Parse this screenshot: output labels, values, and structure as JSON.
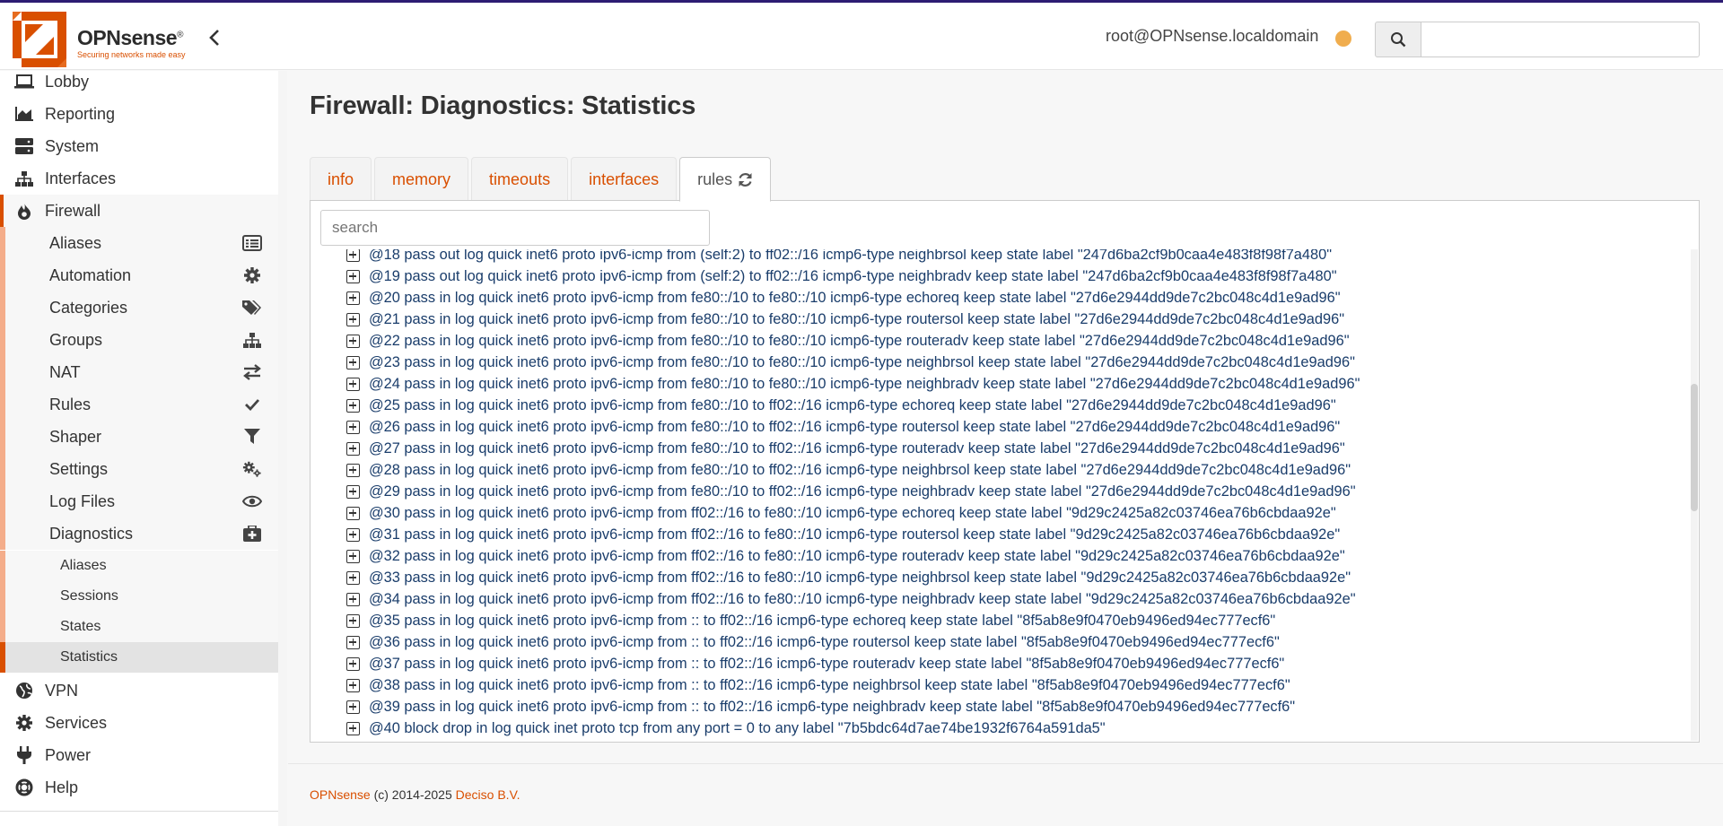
{
  "colors": {
    "accent": "#d94f00",
    "header_line": "#2d1c73",
    "status_dot": "#f0ad4e",
    "rule_text": "#1a3d6b"
  },
  "header": {
    "brand": "OPNsense",
    "brand_mark": "®",
    "tagline": "Securing networks made easy",
    "user": "root@OPNsense.localdomain",
    "search_placeholder": ""
  },
  "sidebar": {
    "items": [
      {
        "label": "Lobby",
        "icon": "laptop-icon"
      },
      {
        "label": "Reporting",
        "icon": "area-chart-icon"
      },
      {
        "label": "System",
        "icon": "server-icon"
      },
      {
        "label": "Interfaces",
        "icon": "sitemap-icon"
      },
      {
        "label": "Firewall",
        "icon": "fire-icon"
      },
      {
        "label": "VPN",
        "icon": "globe-icon"
      },
      {
        "label": "Services",
        "icon": "cog-icon"
      },
      {
        "label": "Power",
        "icon": "plug-icon"
      },
      {
        "label": "Help",
        "icon": "life-ring-icon"
      }
    ],
    "firewall_sub": [
      {
        "label": "Aliases",
        "icon": "list-icon"
      },
      {
        "label": "Automation",
        "icon": "cog-icon"
      },
      {
        "label": "Categories",
        "icon": "tags-icon"
      },
      {
        "label": "Groups",
        "icon": "sitemap-icon"
      },
      {
        "label": "NAT",
        "icon": "exchange-icon"
      },
      {
        "label": "Rules",
        "icon": "check-icon"
      },
      {
        "label": "Shaper",
        "icon": "filter-icon"
      },
      {
        "label": "Settings",
        "icon": "cogs-icon"
      },
      {
        "label": "Log Files",
        "icon": "eye-icon"
      },
      {
        "label": "Diagnostics",
        "icon": "medkit-icon"
      }
    ],
    "diagnostics_sub": [
      "Aliases",
      "Sessions",
      "States",
      "Statistics"
    ]
  },
  "page": {
    "title": "Firewall: Diagnostics: Statistics",
    "tabs": [
      "info",
      "memory",
      "timeouts",
      "interfaces",
      "rules"
    ],
    "active_tab": "rules",
    "search_placeholder": "search"
  },
  "rules": [
    "@18 pass out log quick inet6 proto ipv6-icmp from (self:2) to ff02::/16 icmp6-type neighbrsol keep state label \"247d6ba2cf9b0caa4e483f8f98f7a480\"",
    "@19 pass out log quick inet6 proto ipv6-icmp from (self:2) to ff02::/16 icmp6-type neighbradv keep state label \"247d6ba2cf9b0caa4e483f8f98f7a480\"",
    "@20 pass in log quick inet6 proto ipv6-icmp from fe80::/10 to fe80::/10 icmp6-type echoreq keep state label \"27d6e2944dd9de7c2bc048c4d1e9ad96\"",
    "@21 pass in log quick inet6 proto ipv6-icmp from fe80::/10 to fe80::/10 icmp6-type routersol keep state label \"27d6e2944dd9de7c2bc048c4d1e9ad96\"",
    "@22 pass in log quick inet6 proto ipv6-icmp from fe80::/10 to fe80::/10 icmp6-type routeradv keep state label \"27d6e2944dd9de7c2bc048c4d1e9ad96\"",
    "@23 pass in log quick inet6 proto ipv6-icmp from fe80::/10 to fe80::/10 icmp6-type neighbrsol keep state label \"27d6e2944dd9de7c2bc048c4d1e9ad96\"",
    "@24 pass in log quick inet6 proto ipv6-icmp from fe80::/10 to fe80::/10 icmp6-type neighbradv keep state label \"27d6e2944dd9de7c2bc048c4d1e9ad96\"",
    "@25 pass in log quick inet6 proto ipv6-icmp from fe80::/10 to ff02::/16 icmp6-type echoreq keep state label \"27d6e2944dd9de7c2bc048c4d1e9ad96\"",
    "@26 pass in log quick inet6 proto ipv6-icmp from fe80::/10 to ff02::/16 icmp6-type routersol keep state label \"27d6e2944dd9de7c2bc048c4d1e9ad96\"",
    "@27 pass in log quick inet6 proto ipv6-icmp from fe80::/10 to ff02::/16 icmp6-type routeradv keep state label \"27d6e2944dd9de7c2bc048c4d1e9ad96\"",
    "@28 pass in log quick inet6 proto ipv6-icmp from fe80::/10 to ff02::/16 icmp6-type neighbrsol keep state label \"27d6e2944dd9de7c2bc048c4d1e9ad96\"",
    "@29 pass in log quick inet6 proto ipv6-icmp from fe80::/10 to ff02::/16 icmp6-type neighbradv keep state label \"27d6e2944dd9de7c2bc048c4d1e9ad96\"",
    "@30 pass in log quick inet6 proto ipv6-icmp from ff02::/16 to fe80::/10 icmp6-type echoreq keep state label \"9d29c2425a82c03746ea76b6cbdaa92e\"",
    "@31 pass in log quick inet6 proto ipv6-icmp from ff02::/16 to fe80::/10 icmp6-type routersol keep state label \"9d29c2425a82c03746ea76b6cbdaa92e\"",
    "@32 pass in log quick inet6 proto ipv6-icmp from ff02::/16 to fe80::/10 icmp6-type routeradv keep state label \"9d29c2425a82c03746ea76b6cbdaa92e\"",
    "@33 pass in log quick inet6 proto ipv6-icmp from ff02::/16 to fe80::/10 icmp6-type neighbrsol keep state label \"9d29c2425a82c03746ea76b6cbdaa92e\"",
    "@34 pass in log quick inet6 proto ipv6-icmp from ff02::/16 to fe80::/10 icmp6-type neighbradv keep state label \"9d29c2425a82c03746ea76b6cbdaa92e\"",
    "@35 pass in log quick inet6 proto ipv6-icmp from :: to ff02::/16 icmp6-type echoreq keep state label \"8f5ab8e9f0470eb9496ed94ec777ecf6\"",
    "@36 pass in log quick inet6 proto ipv6-icmp from :: to ff02::/16 icmp6-type routersol keep state label \"8f5ab8e9f0470eb9496ed94ec777ecf6\"",
    "@37 pass in log quick inet6 proto ipv6-icmp from :: to ff02::/16 icmp6-type routeradv keep state label \"8f5ab8e9f0470eb9496ed94ec777ecf6\"",
    "@38 pass in log quick inet6 proto ipv6-icmp from :: to ff02::/16 icmp6-type neighbrsol keep state label \"8f5ab8e9f0470eb9496ed94ec777ecf6\"",
    "@39 pass in log quick inet6 proto ipv6-icmp from :: to ff02::/16 icmp6-type neighbradv keep state label \"8f5ab8e9f0470eb9496ed94ec777ecf6\"",
    "@40 block drop in log quick inet proto tcp from any port = 0 to any label \"7b5bdc64d7ae74be1932f6764a591da5\""
  ],
  "footer": {
    "brand": "OPNsense",
    "copyright": "(c) 2014-2025",
    "company": "Deciso B.V."
  }
}
